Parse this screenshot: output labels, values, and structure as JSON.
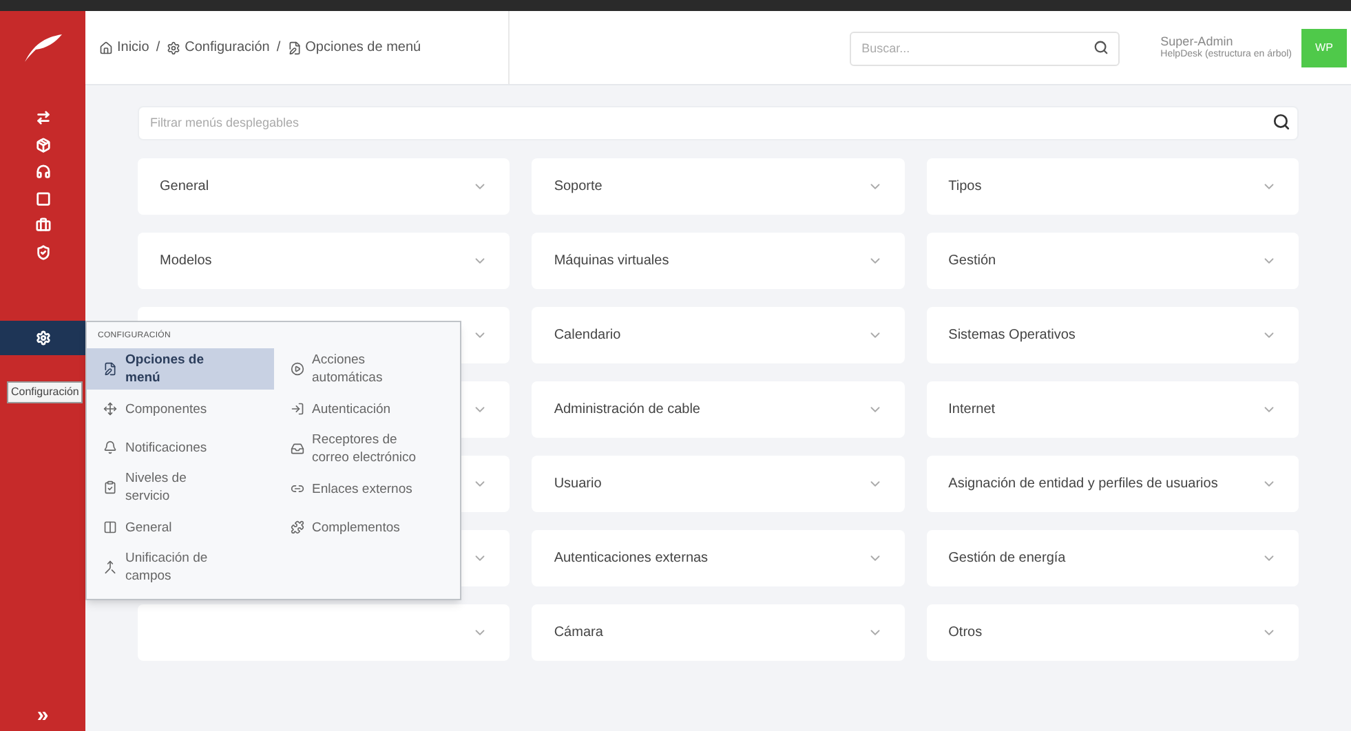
{
  "sidebar": {
    "items": [
      {
        "selected": false
      },
      {
        "selected": false
      },
      {
        "selected": false
      },
      {
        "selected": false
      },
      {
        "selected": false
      },
      {
        "selected": false
      },
      {
        "selected": true
      }
    ],
    "expand": "»"
  },
  "breadcrumb": [
    "Inicio",
    "Configuración",
    "Opciones de menú"
  ],
  "breadcrumb_separator": "/",
  "search": {
    "placeholder": "Buscar..."
  },
  "user": {
    "name": "Super-Admin",
    "profile": "HelpDesk (estructura en árbol)",
    "initials": "WP"
  },
  "filter": {
    "placeholder": "Filtrar menús desplegables"
  },
  "cards": [
    {
      "kind": "dropdown",
      "label": "General"
    },
    {
      "kind": "dropdown",
      "label": "Soporte"
    },
    {
      "kind": "dropdown",
      "label": "Tipos"
    },
    {
      "kind": "dropdown",
      "label": "Modelos"
    },
    {
      "kind": "dropdown",
      "label": "Máquinas virtuales"
    },
    {
      "kind": "dropdown",
      "label": "Gestión"
    },
    {
      "kind": "covered"
    },
    {
      "kind": "dropdown",
      "label": "Calendario"
    },
    {
      "kind": "dropdown",
      "label": "Sistemas Operativos"
    },
    {
      "kind": "covered"
    },
    {
      "kind": "dropdown",
      "label": "Administración de cable"
    },
    {
      "kind": "dropdown",
      "label": "Internet"
    },
    {
      "kind": "covered"
    },
    {
      "kind": "dropdown",
      "label": "Usuario"
    },
    {
      "kind": "dropdown",
      "label": "Asignación de entidad y perfiles de usuarios"
    },
    {
      "kind": "covered"
    },
    {
      "kind": "dropdown",
      "label": "Autenticaciones externas"
    },
    {
      "kind": "dropdown",
      "label": "Gestión de energía"
    },
    {
      "kind": "covered"
    },
    {
      "kind": "dropdown",
      "label": "Cámara"
    },
    {
      "kind": "dropdown",
      "label": "Otros"
    }
  ],
  "popup": {
    "title": "CONFIGURACIÓN",
    "columns": [
      [
        {
          "label": "Opciones de menú",
          "selected": true
        },
        {
          "label": "Componentes",
          "selected": false
        },
        {
          "label": "Notificaciones",
          "selected": false
        },
        {
          "label": "Niveles de servicio",
          "selected": false
        },
        {
          "label": "General",
          "selected": false
        },
        {
          "label": "Unificación de campos",
          "selected": false
        }
      ],
      [
        {
          "label": "Acciones automáticas",
          "selected": false
        },
        {
          "label": "Autenticación",
          "selected": false
        },
        {
          "label": "Receptores de correo electrónico",
          "selected": false
        },
        {
          "label": "Enlaces externos",
          "selected": false
        },
        {
          "label": "Complementos",
          "selected": false
        }
      ]
    ]
  },
  "tooltip": "Configuración"
}
